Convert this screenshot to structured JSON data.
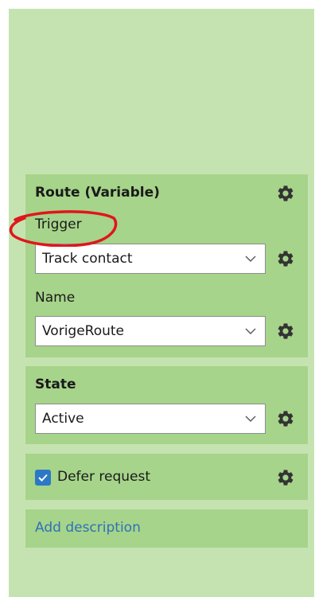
{
  "route": {
    "title": "Route (Variable)",
    "trigger_label": "Trigger",
    "trigger_value": "Track contact",
    "name_label": "Name",
    "name_value": "VorigeRoute"
  },
  "state": {
    "title": "State",
    "value": "Active"
  },
  "defer": {
    "label": "Defer request",
    "checked": true
  },
  "description": {
    "link": "Add description"
  },
  "colors": {
    "panel_bg": "#c5e3b0",
    "section_bg": "#a6d48a",
    "checkbox": "#2b79c6",
    "link": "#2f72b6",
    "highlight": "#e0161b"
  },
  "icons": {
    "settings": "gear-icon",
    "dropdown": "chevron-down-icon",
    "check": "checkmark-icon"
  }
}
